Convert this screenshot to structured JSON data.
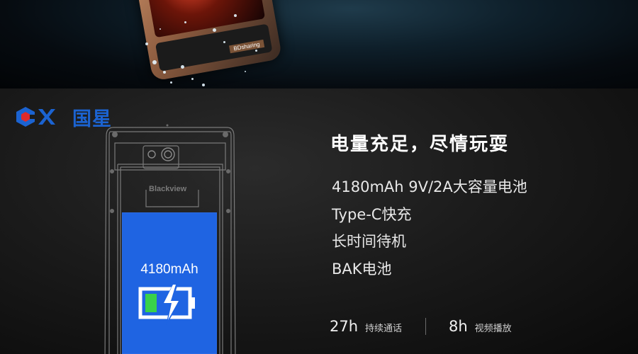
{
  "logo": {
    "mark_text": "CX",
    "name": "国星"
  },
  "hero": {
    "phone_brand_label": "BDsharing"
  },
  "phone_drawing": {
    "brand_label": "Blackview"
  },
  "battery": {
    "capacity_label": "4180mAh"
  },
  "heading": "电量充足，尽情玩耍",
  "features": [
    "4180mAh 9V/2A大容量电池",
    "Type-C快充",
    "长时间待机",
    "BAK电池"
  ],
  "stats": [
    {
      "value": "27h",
      "label": "持续通话"
    },
    {
      "value": "8h",
      "label": "视频播放"
    }
  ],
  "colors": {
    "accent_blue": "#1f64e2",
    "logo_blue": "#1b63d1",
    "logo_red": "#e02a2a",
    "battery_green": "#39d14a"
  },
  "icons": {
    "battery": "battery-charging-icon",
    "logo": "cx-logo-icon"
  }
}
